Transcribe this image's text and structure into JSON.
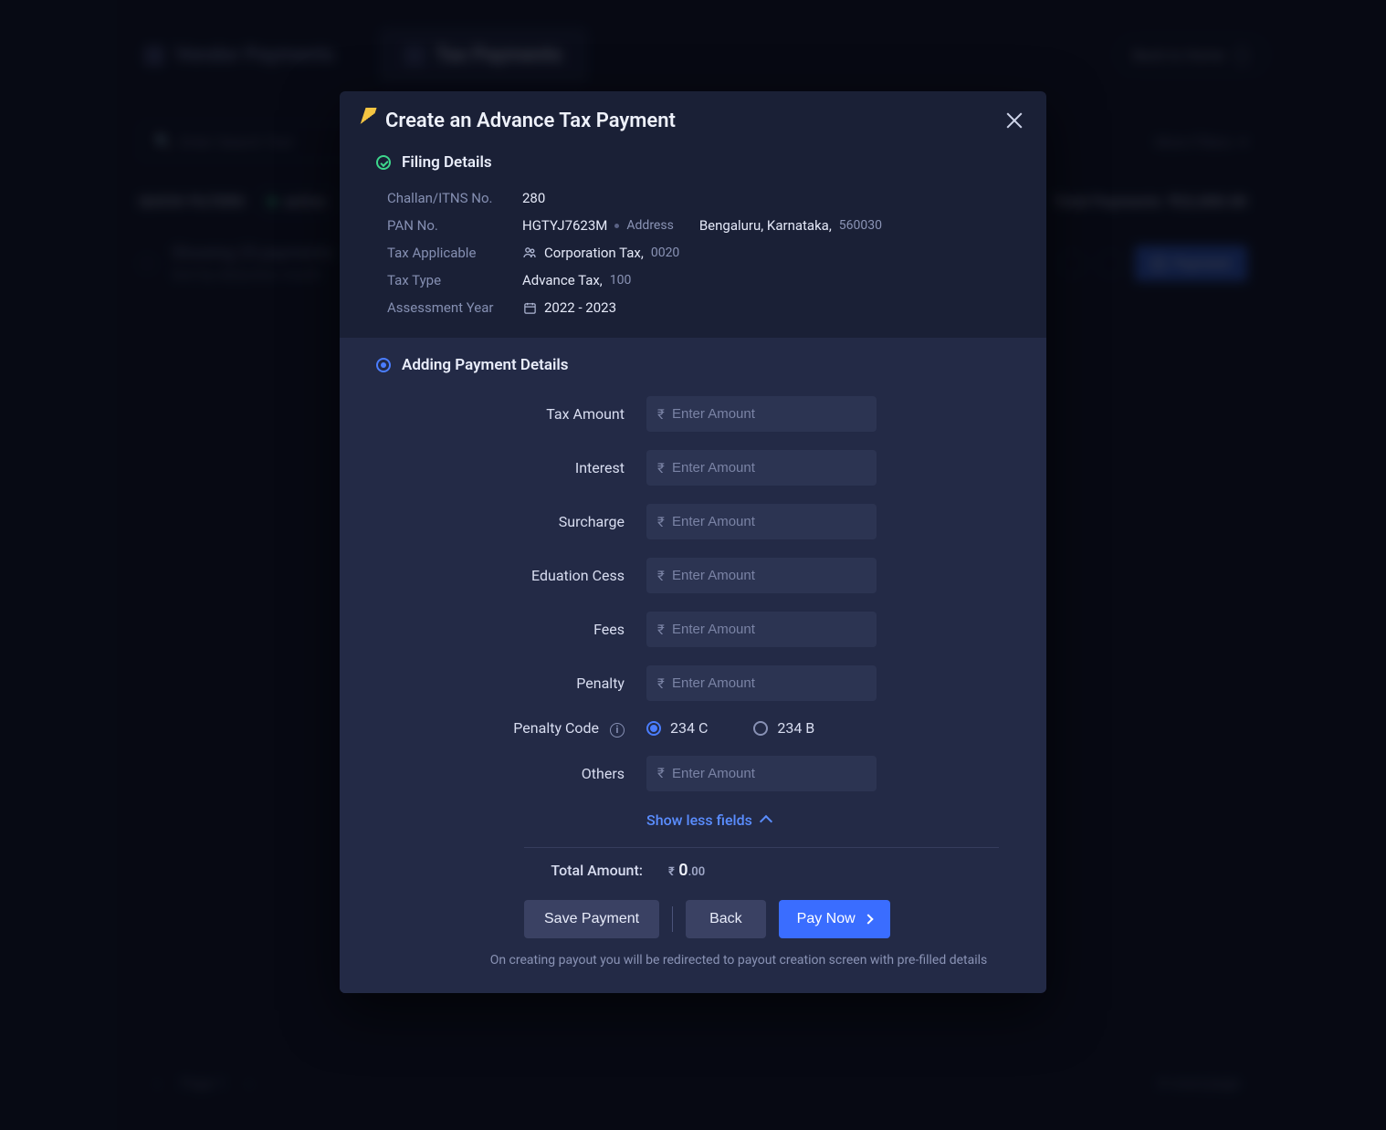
{
  "background": {
    "tabs": [
      {
        "label": "Vendor Payments",
        "active": false
      },
      {
        "label": "Tax Payments",
        "active": true
      }
    ],
    "back_home": "Back to Home",
    "search_placeholder": "Enter Search Text",
    "quick_filters_label": "QUICK FILTERS",
    "filter_chip": "active",
    "more_filters": "More Filters",
    "summary": "Showing 25 payments",
    "sort_label": "Sort by",
    "sort_value": "deduction month",
    "total_label": "Total Payments",
    "total_value": "₹22,000.00",
    "payment_button": "Payment",
    "page_label": "Page 1",
    "rows_label": "# rows/page"
  },
  "modal": {
    "title": "Create an Advance Tax Payment",
    "filing": {
      "section_title": "Filing Details",
      "rows": {
        "challan_label": "Challan/ITNS No.",
        "challan_value": "280",
        "pan_label": "PAN No.",
        "pan_value": "HGTYJ7623M",
        "address_label": "Address",
        "address_value": "Bengaluru, Karnataka,",
        "address_code": "560030",
        "tax_applicable_label": "Tax Applicable",
        "tax_applicable_value": "Corporation Tax,",
        "tax_applicable_code": "0020",
        "tax_type_label": "Tax Type",
        "tax_type_value": "Advance Tax,",
        "tax_type_code": "100",
        "year_label": "Assessment Year",
        "year_value": "2022 - 2023"
      }
    },
    "payment": {
      "section_title": "Adding Payment Details",
      "placeholder": "Enter Amount",
      "fields": {
        "tax_amount": "Tax Amount",
        "interest": "Interest",
        "surcharge": "Surcharge",
        "education_cess": "Eduation Cess",
        "fees": "Fees",
        "penalty": "Penalty",
        "penalty_code": "Penalty Code",
        "others": "Others"
      },
      "penalty_options": {
        "a": "234 C",
        "b": "234 B"
      },
      "toggle_link": "Show less fields",
      "total_label": "Total Amount:",
      "total_int": "0",
      "total_dec": ".00",
      "save": "Save Payment",
      "back": "Back",
      "pay": "Pay Now",
      "hint": "On creating payout you will be redirected to payout creation screen with pre-filled details"
    }
  }
}
